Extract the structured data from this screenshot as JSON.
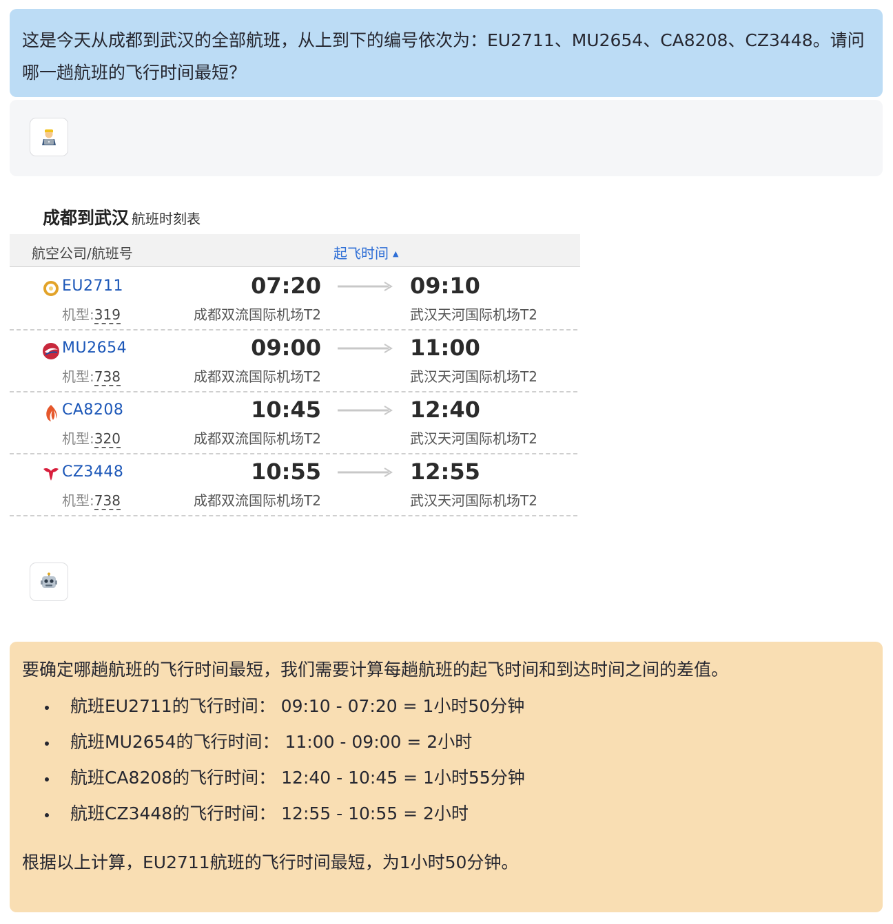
{
  "question": "这是今天从成都到武汉的全部航班，从上到下的编号依次为：EU2711、MU2654、CA8208、CZ3448。请问哪一趟航班的飞行时间最短？",
  "user_avatar_icon": "technologist-icon",
  "bot_avatar_icon": "robot-icon",
  "schedule": {
    "title": "成都到武汉",
    "subtitle": "航班时刻表",
    "col_airline": "航空公司/航班号",
    "col_departure": "起飞时间",
    "sort_icon": "sort-up-icon",
    "model_label": "机型:",
    "flights": [
      {
        "flight_no": "EU2711",
        "model": "319",
        "dep_time": "07:20",
        "dep_airport": "成都双流国际机场T2",
        "arr_time": "09:10",
        "arr_airport": "武汉天河国际机场T2",
        "logo": "chengdu-airlines-logo",
        "logo_color": "#e2a329"
      },
      {
        "flight_no": "MU2654",
        "model": "738",
        "dep_time": "09:00",
        "dep_airport": "成都双流国际机场T2",
        "arr_time": "11:00",
        "arr_airport": "武汉天河国际机场T2",
        "logo": "china-eastern-logo",
        "logo_color": "#c8283c"
      },
      {
        "flight_no": "CA8208",
        "model": "320",
        "dep_time": "10:45",
        "dep_airport": "成都双流国际机场T2",
        "arr_time": "12:40",
        "arr_airport": "武汉天河国际机场T2",
        "logo": "air-china-logo",
        "logo_color": "#e5572b"
      },
      {
        "flight_no": "CZ3448",
        "model": "738",
        "dep_time": "10:55",
        "dep_airport": "成都双流国际机场T2",
        "arr_time": "12:55",
        "arr_airport": "武汉天河国际机场T2",
        "logo": "china-southern-logo",
        "logo_color": "#d81e3c"
      }
    ]
  },
  "answer": {
    "intro": "要确定哪趟航班的飞行时间最短，我们需要计算每趟航班的起飞时间和到达时间之间的差值。",
    "items": [
      "航班EU2711的飞行时间：  09:10 - 07:20 = 1小时50分钟",
      "航班MU2654的飞行时间：  11:00 - 09:00 = 2小时",
      "航班CA8208的飞行时间：  12:40 - 10:45 = 1小时55分钟",
      "航班CZ3448的飞行时间：  12:55 - 10:55 = 2小时"
    ],
    "conclusion": "根据以上计算，EU2711航班的飞行时间最短，为1小时50分钟。"
  },
  "colors": {
    "question_bg": "#bcdcf5",
    "answer_bg": "#f9deb3",
    "flight_no": "#1c57b8",
    "header_link": "#2f6fd6"
  }
}
